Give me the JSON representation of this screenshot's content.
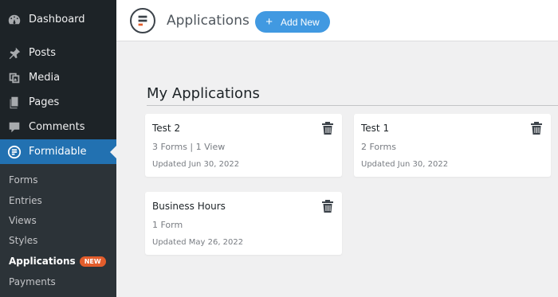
{
  "sidebar": {
    "menu": [
      {
        "label": "Dashboard",
        "icon": "dashboard-icon"
      },
      {
        "label": "Posts",
        "icon": "pin-icon"
      },
      {
        "label": "Media",
        "icon": "media-icon"
      },
      {
        "label": "Pages",
        "icon": "pages-icon"
      },
      {
        "label": "Comments",
        "icon": "comment-icon"
      },
      {
        "label": "Formidable",
        "icon": "formidable-logo-icon"
      }
    ],
    "submenu": [
      {
        "label": "Forms"
      },
      {
        "label": "Entries"
      },
      {
        "label": "Views"
      },
      {
        "label": "Styles"
      },
      {
        "label": "Applications",
        "badge": "NEW"
      },
      {
        "label": "Payments"
      }
    ]
  },
  "header": {
    "title": "Applications",
    "add_new_label": "Add New"
  },
  "main": {
    "section_title": "My Applications",
    "cards": [
      {
        "name": "Test 2",
        "meta": "3 Forms | 1 View",
        "updated": "Updated Jun 30, 2022"
      },
      {
        "name": "Test 1",
        "meta": "2 Forms",
        "updated": "Updated Jun 30, 2022"
      },
      {
        "name": "Business Hours",
        "meta": "1 Form",
        "updated": "Updated May 26, 2022"
      }
    ]
  },
  "colors": {
    "sidebar_bg": "#1d2327",
    "active_bg": "#2271b1",
    "button_blue": "#4199e1",
    "badge_orange": "#e35d2c"
  }
}
